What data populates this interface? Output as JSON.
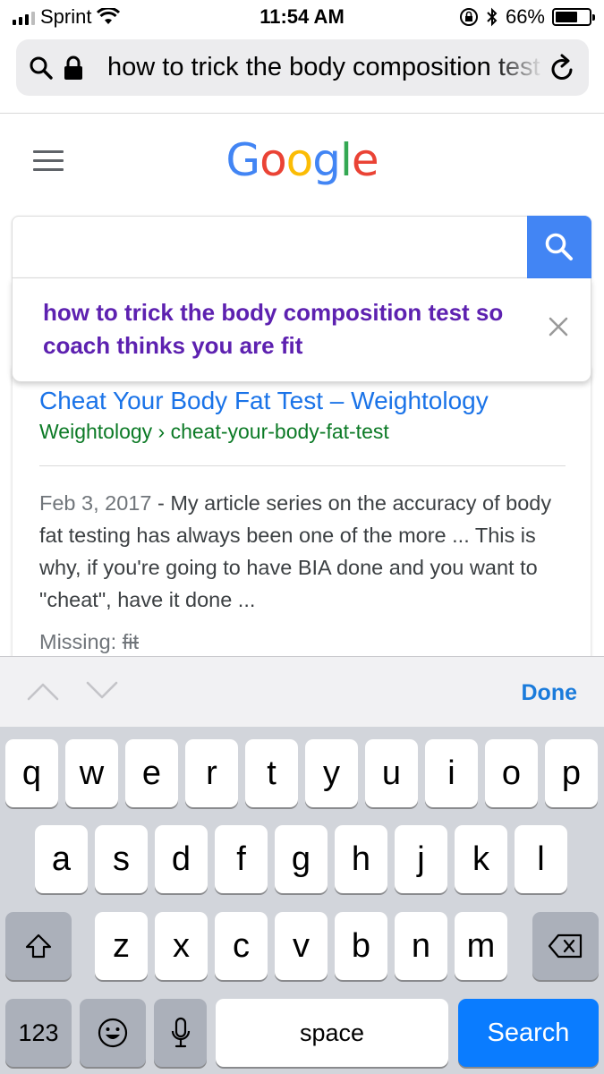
{
  "status_bar": {
    "carrier": "Sprint",
    "time": "11:54 AM",
    "battery_percent": "66%",
    "battery_level": 0.66
  },
  "url_bar": {
    "url_text": "how to trick the body composition test so coach thinks you are fit"
  },
  "google": {
    "logo_letters": [
      {
        "ch": "G",
        "color": "#4285f4"
      },
      {
        "ch": "o",
        "color": "#ea4335"
      },
      {
        "ch": "o",
        "color": "#fbbc05"
      },
      {
        "ch": "g",
        "color": "#4285f4"
      },
      {
        "ch": "l",
        "color": "#34a853"
      },
      {
        "ch": "e",
        "color": "#ea4335"
      }
    ]
  },
  "search": {
    "query": "",
    "suggestion": "how to trick the body composition test so coach thinks you are fit"
  },
  "result": {
    "title": "Cheat Your Body Fat Test – Weightology",
    "url": "Weightology › cheat-your-body-fat-test",
    "date": "Feb 3, 2017",
    "snippet": " - My article series on the accuracy of body fat testing has always been one of the more ... This is why, if you're going to have BIA done and you want to \"cheat\", have it done ...",
    "missing_label": "Missing: ",
    "missing_term": "fit"
  },
  "accessory_bar": {
    "done_label": "Done"
  },
  "keyboard": {
    "row1": [
      "q",
      "w",
      "e",
      "r",
      "t",
      "y",
      "u",
      "i",
      "o",
      "p"
    ],
    "row2": [
      "a",
      "s",
      "d",
      "f",
      "g",
      "h",
      "j",
      "k",
      "l"
    ],
    "row3": [
      "z",
      "x",
      "c",
      "v",
      "b",
      "n",
      "m"
    ],
    "numbers_label": "123",
    "space_label": "space",
    "search_label": "Search"
  },
  "colors": {
    "accent_blue": "#4285f4",
    "suggestion_purple": "#5d21b0",
    "keyboard_blue": "#0a7cff"
  }
}
